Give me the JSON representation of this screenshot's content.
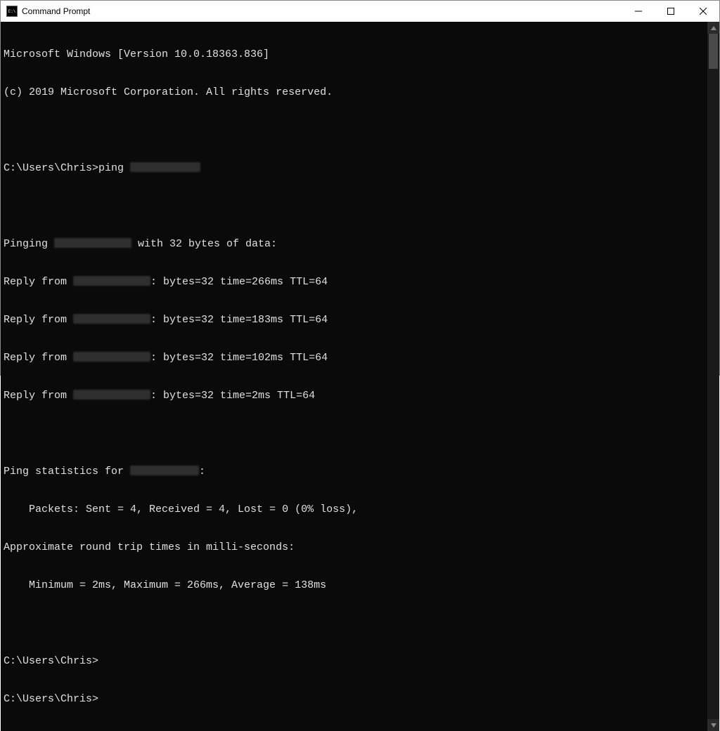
{
  "window": {
    "title": "Command Prompt"
  },
  "banner": {
    "l1": "Microsoft Windows [Version 10.0.18363.836]",
    "l2": "(c) 2019 Microsoft Corporation. All rights reserved."
  },
  "command": {
    "prompt": "C:\\Users\\Chris>",
    "cmd": "ping "
  },
  "ping": {
    "header_pre": "Pinging ",
    "header_post": " with 32 bytes of data:",
    "reply_pre": "Reply from ",
    "reply_post1": ": bytes=32 time=266ms TTL=64",
    "reply_post2": ": bytes=32 time=183ms TTL=64",
    "reply_post3": ": bytes=32 time=102ms TTL=64",
    "reply_post4": ": bytes=32 time=2ms TTL=64"
  },
  "stats": {
    "header_pre": "Ping statistics for ",
    "header_post": ":",
    "packets": "    Packets: Sent = 4, Received = 4, Lost = 0 (0% loss),",
    "approx": "Approximate round trip times in milli-seconds:",
    "times": "    Minimum = 2ms, Maximum = 266ms, Average = 138ms"
  },
  "tail": {
    "p1": "C:\\Users\\Chris>",
    "p2": "C:\\Users\\Chris>"
  }
}
